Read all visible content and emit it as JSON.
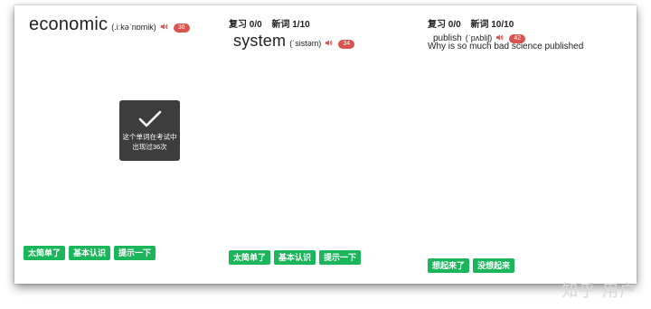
{
  "panel1": {
    "word": "economic",
    "phonetic": "(.iːkəˈnɒmik)",
    "count_badge": "36",
    "toast_line1": "这个单词在考试中",
    "toast_line2": "出现过36次",
    "buttons": [
      "太简单了",
      "基本认识",
      "提示一下"
    ]
  },
  "panel2": {
    "review_label": "复习 0/0",
    "new_label": "新词 1/10",
    "word": "system",
    "phonetic": "(ˈsistəm)",
    "count_badge": "34",
    "buttons": [
      "太简单了",
      "基本认识",
      "提示一下"
    ]
  },
  "panel3": {
    "review_label": "复习 0/0",
    "new_label": "新词 10/10",
    "word": "publish",
    "phonetic": "(ˈpʌbliʃ)",
    "count_badge": "42",
    "sentence": "Why is so much bad science published",
    "buttons": [
      "想起来了",
      "没想起来"
    ]
  },
  "watermark": "知乎 用户",
  "colors": {
    "button_green": "#1bb55c",
    "badge_red": "#d9534f",
    "toast_bg": "#3d3d3d",
    "speaker_red": "#d9534f"
  },
  "icons": [
    "speaker-icon",
    "checkmark-icon"
  ]
}
